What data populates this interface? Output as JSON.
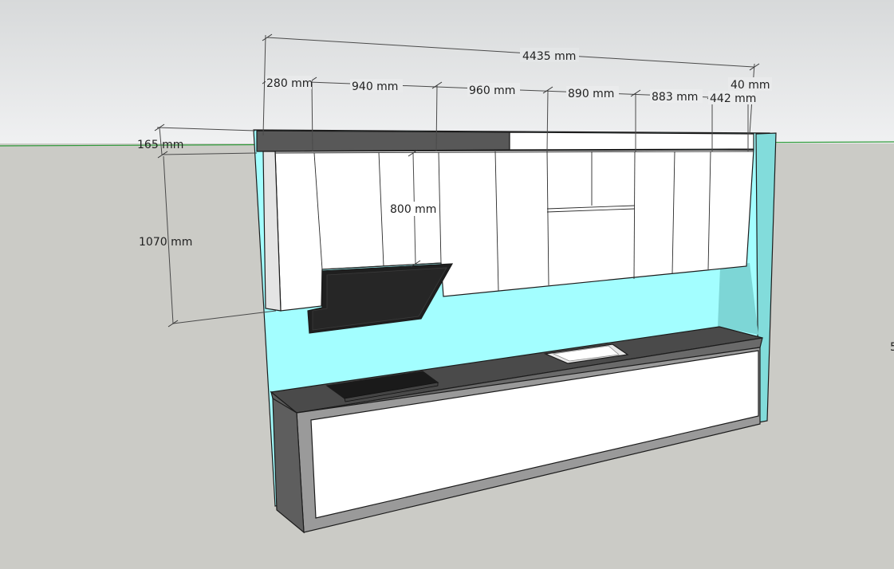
{
  "dimensions": {
    "overall_width": "4435 mm",
    "seg_1": "280 mm",
    "seg_2": "940 mm",
    "seg_3": "960 mm",
    "seg_4": "890 mm",
    "seg_5": "883 mm",
    "seg_6": "442 mm",
    "seg_7": "40 mm",
    "top_panel_height": "165 mm",
    "wall_unit_height": "1070 mm",
    "hood_cabinet_height": "800 mm"
  },
  "edge_text": "5",
  "colors": {
    "sky_top": "#dcdedf",
    "sky_bottom": "#eeeff0",
    "ground": "#cbcbc6",
    "horizon": "#2f9a3a",
    "backsplash": "#a3feff",
    "backsplash_side": "#7fd9d8",
    "cabinet": "#ffffff",
    "countertop": "#4a4a4a",
    "base_frame": "#9a9a9a",
    "hood": "#1e1e1e"
  }
}
